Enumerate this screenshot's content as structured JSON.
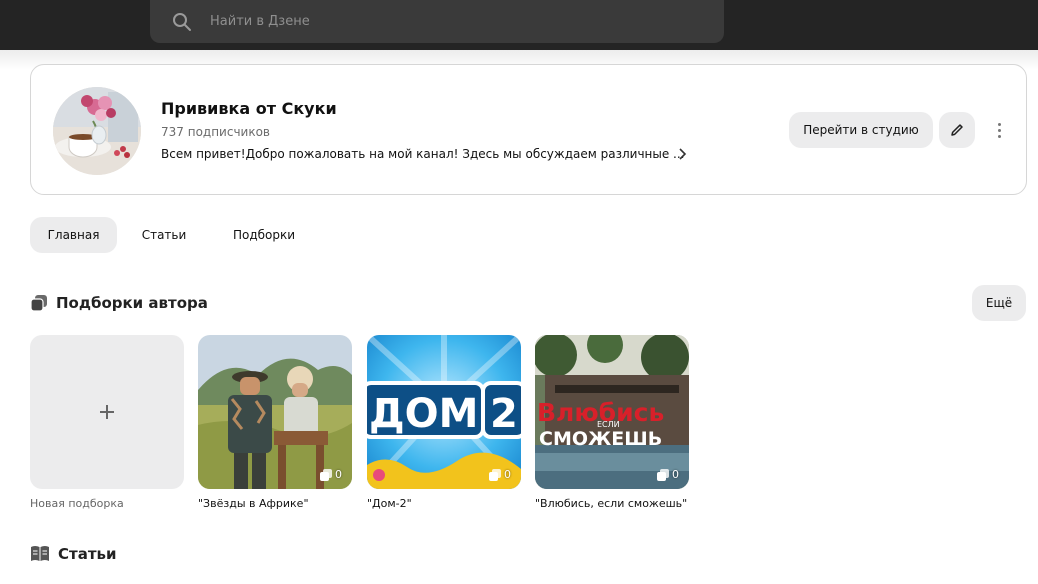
{
  "search": {
    "placeholder": "Найти в Дзене"
  },
  "channel": {
    "name": "Прививка от Скуки",
    "subscribers": "737 подписчиков",
    "description": "Всем привет!Добро пожаловать на мой канал! Здесь мы обсуждаем различные ...",
    "studio_button": "Перейти в студию"
  },
  "tabs": [
    {
      "label": "Главная",
      "active": true
    },
    {
      "label": "Статьи",
      "active": false
    },
    {
      "label": "Подборки",
      "active": false
    }
  ],
  "collections": {
    "title": "Подборки автора",
    "more_label": "Ещё",
    "new_label": "Новая подборка",
    "items": [
      {
        "caption": "\"Звёзды в Африке\"",
        "count": "0"
      },
      {
        "caption": "\"Дом-2\"",
        "count": "0",
        "logo_left": "ДОМ",
        "logo_right": "2"
      },
      {
        "caption": "\"Влюбись, если сможешь\"",
        "count": "0",
        "logo_top": "Влюбись",
        "logo_small": "ЕСЛИ",
        "logo_bottom": "СМОЖЕШЬ"
      }
    ]
  },
  "articles": {
    "title": "Статьи"
  },
  "icons": {
    "search": "search-icon",
    "edit": "pencil-icon",
    "more": "more-vertical-icon",
    "collections": "collections-icon",
    "articles": "book-icon",
    "count": "stack-icon"
  }
}
